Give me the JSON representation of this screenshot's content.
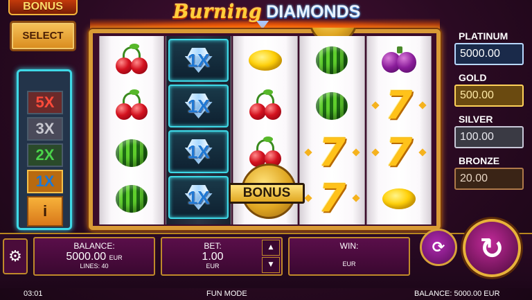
{
  "header": {
    "bonus_tag": "BONUS",
    "select_label": "SELECT",
    "logo_part1": "Burning",
    "logo_part2": "DIAMONDS"
  },
  "multipliers": [
    "5X",
    "3X",
    "2X",
    "1X",
    "i"
  ],
  "reels": [
    [
      "cherry",
      "cherry",
      "watermelon",
      "watermelon"
    ],
    [
      "diamond-1x",
      "diamond-1x",
      "diamond-1x",
      "diamond-1x"
    ],
    [
      "lemon",
      "cherry",
      "cherry",
      "bonus-coin"
    ],
    [
      "watermelon",
      "watermelon",
      "seven",
      "seven"
    ],
    [
      "plum",
      "seven",
      "seven",
      "lemon"
    ]
  ],
  "diamond_label": "1X",
  "seven_label": "7",
  "bonus_symbol_label": "BONUS",
  "jackpots": {
    "platinum": {
      "label": "PLATINUM",
      "value": "5000.00"
    },
    "gold": {
      "label": "GOLD",
      "value": "500.00"
    },
    "silver": {
      "label": "SILVER",
      "value": "100.00"
    },
    "bronze": {
      "label": "BRONZE",
      "value": "20.00"
    }
  },
  "balance_panel": {
    "title": "BALANCE:",
    "value": "5000.00",
    "currency": "EUR",
    "lines": "LINES: 40"
  },
  "bet_panel": {
    "title": "BET:",
    "value": "1.00",
    "currency": "EUR",
    "up": "▲",
    "down": "▼"
  },
  "win_panel": {
    "title": "WIN:",
    "currency": "EUR"
  },
  "status_bar": {
    "time": "03:01",
    "mode": "FUN MODE",
    "balance": "BALANCE: 5000.00 EUR"
  },
  "icons": {
    "settings": "gear-icon",
    "autospin": "autoplay-icon",
    "spin": "spin-icon"
  },
  "colors": {
    "accent_gold": "#d99a35",
    "background": "#2a0a22",
    "diamond_glow": "#3ed8e6"
  }
}
